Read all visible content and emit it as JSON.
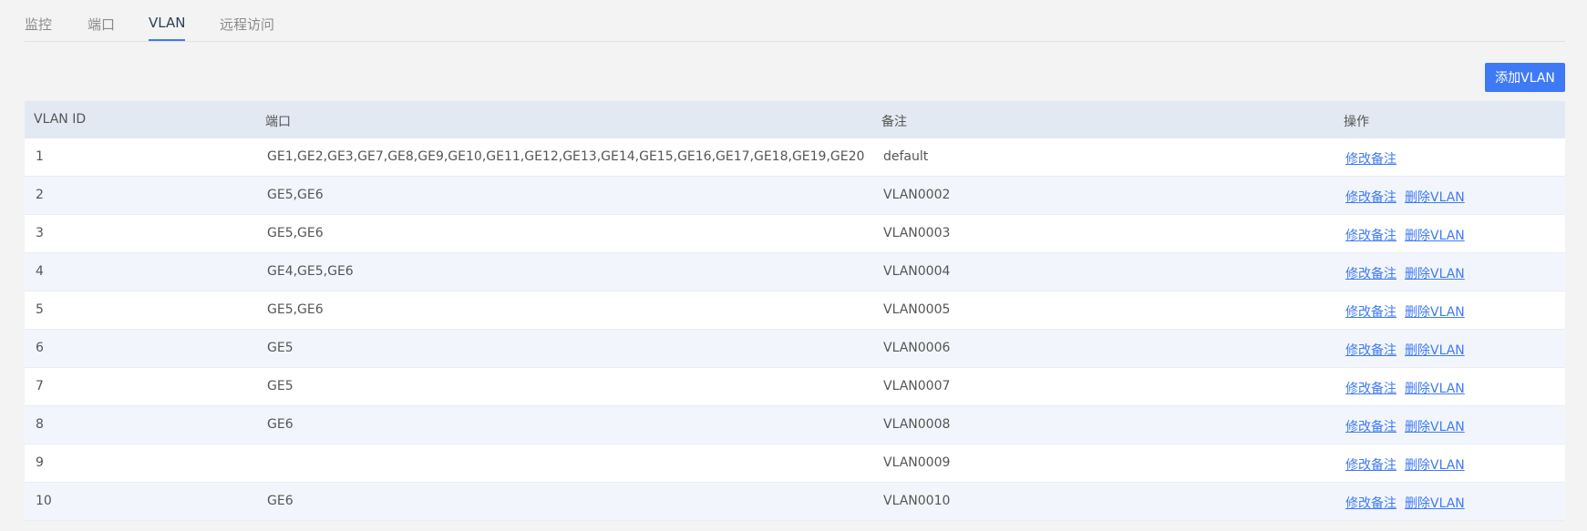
{
  "tabs": [
    {
      "label": "监控"
    },
    {
      "label": "端口"
    },
    {
      "label": "VLAN"
    },
    {
      "label": "远程访问"
    }
  ],
  "active_tab": "VLAN",
  "toolbar": {
    "add_label": "添加VLAN"
  },
  "table": {
    "headers": {
      "id": "VLAN ID",
      "ports": "端口",
      "note": "备注",
      "ops": "操作"
    },
    "edit_label": "修改备注",
    "delete_label": "删除VLAN",
    "rows": [
      {
        "id": "1",
        "ports": "GE1,GE2,GE3,GE7,GE8,GE9,GE10,GE11,GE12,GE13,GE14,GE15,GE16,GE17,GE18,GE19,GE20",
        "note": "default"
      },
      {
        "id": "2",
        "ports": "GE5,GE6",
        "note": "VLAN0002"
      },
      {
        "id": "3",
        "ports": "GE5,GE6",
        "note": "VLAN0003"
      },
      {
        "id": "4",
        "ports": "GE4,GE5,GE6",
        "note": "VLAN0004"
      },
      {
        "id": "5",
        "ports": "GE5,GE6",
        "note": "VLAN0005"
      },
      {
        "id": "6",
        "ports": "GE5",
        "note": "VLAN0006"
      },
      {
        "id": "7",
        "ports": "GE5",
        "note": "VLAN0007"
      },
      {
        "id": "8",
        "ports": "GE6",
        "note": "VLAN0008"
      },
      {
        "id": "9",
        "ports": "",
        "note": "VLAN0009"
      },
      {
        "id": "10",
        "ports": "GE6",
        "note": "VLAN0010"
      }
    ]
  },
  "colors": {
    "accent": "#3f7af6",
    "header_bg": "#e3e9f2",
    "row_alt_bg": "#f2f6fc"
  }
}
